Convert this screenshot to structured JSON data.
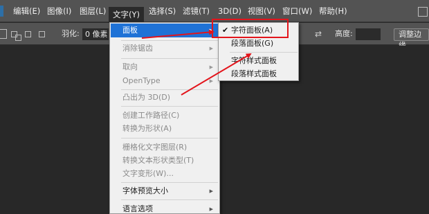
{
  "menubar": {
    "items": [
      {
        "label": "编辑(E)"
      },
      {
        "label": "图像(I)"
      },
      {
        "label": "图层(L)"
      },
      {
        "label": "文字(Y)"
      },
      {
        "label": "选择(S)"
      },
      {
        "label": "滤镜(T)"
      },
      {
        "label": "3D(D)"
      },
      {
        "label": "视图(V)"
      },
      {
        "label": "窗口(W)"
      },
      {
        "label": "帮助(H)"
      }
    ]
  },
  "options_bar": {
    "feather_label": "羽化:",
    "feather_value": "0 像素",
    "height_label": "高度:",
    "height_value": "",
    "refine_edge_label": "调整边缘"
  },
  "text_menu": {
    "items": [
      {
        "label": "面板",
        "state": "highlighted",
        "submenu": true
      },
      {
        "label": "消除锯齿",
        "state": "disabled",
        "submenu": true
      },
      {
        "label": "取向",
        "state": "disabled",
        "submenu": true
      },
      {
        "label": "OpenType",
        "state": "disabled",
        "submenu": true
      },
      {
        "label": "凸出为 3D(D)",
        "state": "disabled"
      },
      {
        "label": "创建工作路径(C)",
        "state": "disabled"
      },
      {
        "label": "转换为形状(A)",
        "state": "disabled"
      },
      {
        "label": "栅格化文字图层(R)",
        "state": "disabled"
      },
      {
        "label": "转换文本形状类型(T)",
        "state": "disabled"
      },
      {
        "label": "文字变形(W)...",
        "state": "disabled"
      },
      {
        "label": "字体预览大小",
        "state": "enabled",
        "submenu": true
      },
      {
        "label": "语言选项",
        "state": "enabled",
        "submenu": true
      }
    ]
  },
  "panel_submenu": {
    "items": [
      {
        "label": "字符面板(A)",
        "checked": true
      },
      {
        "label": "段落面板(G)",
        "checked": false
      },
      {
        "label": "字符样式面板",
        "checked": false
      },
      {
        "label": "段落样式面板",
        "checked": false
      }
    ]
  },
  "icons": {
    "check": "checkmark-icon",
    "submenu_arrow": "triangle-right-icon",
    "swap": "swap-arrows-icon"
  },
  "colors": {
    "menubar_bg": "#535353",
    "menu_highlight": "#1f72d6",
    "annotation_red": "#e3141b",
    "workspace_bg": "#282828"
  }
}
